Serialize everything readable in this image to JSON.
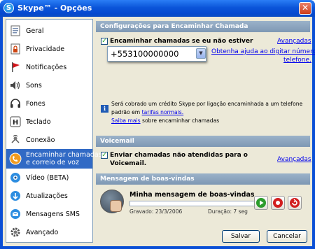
{
  "titlebar": {
    "app": "Skype™ - Opções",
    "close_glyph": "✕"
  },
  "sidebar": {
    "items": [
      {
        "label": "Geral",
        "icon": "general-icon"
      },
      {
        "label": "Privacidade",
        "icon": "privacy-icon"
      },
      {
        "label": "Notificações",
        "icon": "notifications-icon"
      },
      {
        "label": "Sons",
        "icon": "sound-icon"
      },
      {
        "label": "Fones",
        "icon": "headset-icon"
      },
      {
        "label": "Teclado",
        "icon": "keyboard-icon"
      },
      {
        "label": "Conexão",
        "icon": "connection-icon"
      },
      {
        "label": "Encaminhar chamadas",
        "label2": "e correio de voz",
        "icon": "call-forward-icon",
        "selected": true
      },
      {
        "label": "Vídeo (BETA)",
        "icon": "video-icon"
      },
      {
        "label": "Atualizações",
        "icon": "updates-icon"
      },
      {
        "label": "Mensagens SMS",
        "icon": "sms-icon"
      },
      {
        "label": "Avançado",
        "icon": "advanced-icon"
      }
    ]
  },
  "forwarding": {
    "header": "Configurações para Encaminhar Chamada",
    "checkbox_label": "Encaminhar chamadas se eu não estiver",
    "checked": true,
    "phone_value": "+553100000000",
    "advanced_link": "Avançadas",
    "help_link_1": "Obtenha ajuda ao digitar números de",
    "help_link_2": "telefone.",
    "info_line1": "Será cobrado um crédito Skype por ligação encaminhada a um telefone",
    "info_line2_prefix": "padrão em ",
    "info_line2_link": "tarifas normais.",
    "info_line3_link": "Saiba mais",
    "info_line3_suffix": " sobre encaminhar chamadas"
  },
  "voicemail": {
    "header": "Voicemail",
    "checkbox_label_1": "Enviar chamadas não atendidas para o",
    "checkbox_label_2": "Voicemail.",
    "checked": true,
    "advanced_link": "Avançadas"
  },
  "greeting": {
    "header": "Mensagem de boas-vindas",
    "title": "Minha mensagem de boas-vindas",
    "recorded": "Gravado: 23/3/2006",
    "duration": "Duração: 7 seg",
    "progress": 0
  },
  "buttons": {
    "save": "Salvar",
    "cancel": "Cancelar"
  },
  "colors": {
    "accent": "#316ac5",
    "titlebar": "#0b55d9",
    "section_header": "#8aa3bd",
    "link": "#0000ee"
  }
}
